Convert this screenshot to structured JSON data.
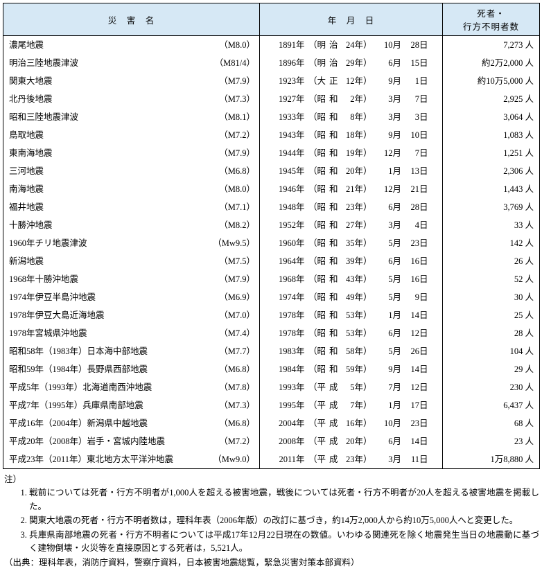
{
  "headers": {
    "name": "災　害　名",
    "date": "年　月　日",
    "deaths": "死者・\n行方不明者数"
  },
  "rows": [
    {
      "name": "濃尾地震",
      "mag": "（M8.0）",
      "gyear": "1891",
      "era": "明治",
      "eyear": "24",
      "month": "10",
      "day": "28",
      "deaths": "7,273 人"
    },
    {
      "name": "明治三陸地震津波",
      "mag": "（M81/4）",
      "gyear": "1896",
      "era": "明治",
      "eyear": "29",
      "month": "6",
      "day": "15",
      "deaths": "約2万2,000 人"
    },
    {
      "name": "関東大地震",
      "mag": "（M7.9）",
      "gyear": "1923",
      "era": "大正",
      "eyear": "12",
      "month": "9",
      "day": "1",
      "deaths": "約10万5,000 人"
    },
    {
      "name": "北丹後地震",
      "mag": "（M7.3）",
      "gyear": "1927",
      "era": "昭和",
      "eyear": "2",
      "month": "3",
      "day": "7",
      "deaths": "2,925 人"
    },
    {
      "name": "昭和三陸地震津波",
      "mag": "（M8.1）",
      "gyear": "1933",
      "era": "昭和",
      "eyear": "8",
      "month": "3",
      "day": "3",
      "deaths": "3,064 人"
    },
    {
      "name": "鳥取地震",
      "mag": "（M7.2）",
      "gyear": "1943",
      "era": "昭和",
      "eyear": "18",
      "month": "9",
      "day": "10",
      "deaths": "1,083 人"
    },
    {
      "name": "東南海地震",
      "mag": "（M7.9）",
      "gyear": "1944",
      "era": "昭和",
      "eyear": "19",
      "month": "12",
      "day": "7",
      "deaths": "1,251 人"
    },
    {
      "name": "三河地震",
      "mag": "（M6.8）",
      "gyear": "1945",
      "era": "昭和",
      "eyear": "20",
      "month": "1",
      "day": "13",
      "deaths": "2,306 人"
    },
    {
      "name": "南海地震",
      "mag": "（M8.0）",
      "gyear": "1946",
      "era": "昭和",
      "eyear": "21",
      "month": "12",
      "day": "21",
      "deaths": "1,443 人"
    },
    {
      "name": "福井地震",
      "mag": "（M7.1）",
      "gyear": "1948",
      "era": "昭和",
      "eyear": "23",
      "month": "6",
      "day": "28",
      "deaths": "3,769 人"
    },
    {
      "name": "十勝沖地震",
      "mag": "（M8.2）",
      "gyear": "1952",
      "era": "昭和",
      "eyear": "27",
      "month": "3",
      "day": "4",
      "deaths": "33 人"
    },
    {
      "name": "1960年チリ地震津波",
      "mag": "（Mw9.5）",
      "gyear": "1960",
      "era": "昭和",
      "eyear": "35",
      "month": "5",
      "day": "23",
      "deaths": "142 人"
    },
    {
      "name": "新潟地震",
      "mag": "（M7.5）",
      "gyear": "1964",
      "era": "昭和",
      "eyear": "39",
      "month": "6",
      "day": "16",
      "deaths": "26 人"
    },
    {
      "name": "1968年十勝沖地震",
      "mag": "（M7.9）",
      "gyear": "1968",
      "era": "昭和",
      "eyear": "43",
      "month": "5",
      "day": "16",
      "deaths": "52 人"
    },
    {
      "name": "1974年伊豆半島沖地震",
      "mag": "（M6.9）",
      "gyear": "1974",
      "era": "昭和",
      "eyear": "49",
      "month": "5",
      "day": "9",
      "deaths": "30 人"
    },
    {
      "name": "1978年伊豆大島近海地震",
      "mag": "（M7.0）",
      "gyear": "1978",
      "era": "昭和",
      "eyear": "53",
      "month": "1",
      "day": "14",
      "deaths": "25 人"
    },
    {
      "name": "1978年宮城県沖地震",
      "mag": "（M7.4）",
      "gyear": "1978",
      "era": "昭和",
      "eyear": "53",
      "month": "6",
      "day": "12",
      "deaths": "28 人"
    },
    {
      "name": "昭和58年（1983年）日本海中部地震",
      "mag": "（M7.7）",
      "gyear": "1983",
      "era": "昭和",
      "eyear": "58",
      "month": "5",
      "day": "26",
      "deaths": "104 人"
    },
    {
      "name": "昭和59年（1984年）長野県西部地震",
      "mag": "（M6.8）",
      "gyear": "1984",
      "era": "昭和",
      "eyear": "59",
      "month": "9",
      "day": "14",
      "deaths": "29 人"
    },
    {
      "name": "平成5年（1993年）北海道南西沖地震",
      "mag": "（M7.8）",
      "gyear": "1993",
      "era": "平成",
      "eyear": "5",
      "month": "7",
      "day": "12",
      "deaths": "230 人"
    },
    {
      "name": "平成7年（1995年）兵庫県南部地震",
      "mag": "（M7.3）",
      "gyear": "1995",
      "era": "平成",
      "eyear": "7",
      "month": "1",
      "day": "17",
      "deaths": "6,437 人"
    },
    {
      "name": "平成16年（2004年）新潟県中越地震",
      "mag": "（M6.8）",
      "gyear": "2004",
      "era": "平成",
      "eyear": "16",
      "month": "10",
      "day": "23",
      "deaths": "68 人"
    },
    {
      "name": "平成20年（2008年）岩手・宮城内陸地震",
      "mag": "（M7.2）",
      "gyear": "2008",
      "era": "平成",
      "eyear": "20",
      "month": "6",
      "day": "14",
      "deaths": "23 人"
    },
    {
      "name": "平成23年（2011年）東北地方太平洋沖地震",
      "mag": "（Mw9.0）",
      "gyear": "2011",
      "era": "平成",
      "eyear": "23",
      "month": "3",
      "day": "11",
      "deaths": "1万8,880 人"
    }
  ],
  "suffixes": {
    "year": "年",
    "month": "月",
    "day": "日",
    "open": "（",
    "close": "年）"
  },
  "notes": {
    "label": "注）",
    "items": [
      "戦前については死者・行方不明者が1,000人を超える被害地震，戦後については死者・行方不明者が20人を超える被害地震を掲載した。",
      "関東大地震の死者・行方不明者数は，理科年表（2006年版）の改訂に基づき，約14万2,000人から約10万5,000人へと変更した。",
      "兵庫県南部地震の死者・行方不明者については平成17年12月22日現在の数値。いわゆる関連死を除く地震発生当日の地震動に基づく建物倒壊・火災等を直接原因とする死者は，5,521人。"
    ],
    "source": "（出典：理科年表，消防庁資料，警察庁資料，日本被害地震総覧，緊急災害対策本部資料）"
  }
}
